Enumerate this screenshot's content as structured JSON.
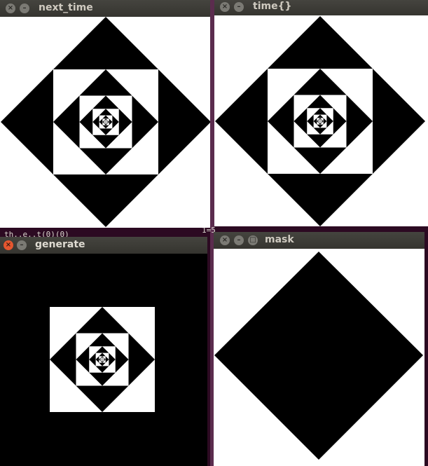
{
  "windows": {
    "next_time": {
      "title": "next_time"
    },
    "time": {
      "title": "time{}"
    },
    "generate": {
      "title": "generate"
    },
    "mask": {
      "title": "mask"
    }
  },
  "buttons": {
    "close_glyph": "×",
    "minimize_glyph": "–",
    "maximize_glyph": "□"
  },
  "background_fragments": {
    "terminal_left": "th..e..t(0)(0)",
    "terminal_right": "1=5"
  },
  "colors": {
    "desktop": "#2c0a22",
    "titlebar": "#3c3b37",
    "close_active": "#e5562f",
    "pattern": "#000000",
    "canvas": "#ffffff"
  }
}
